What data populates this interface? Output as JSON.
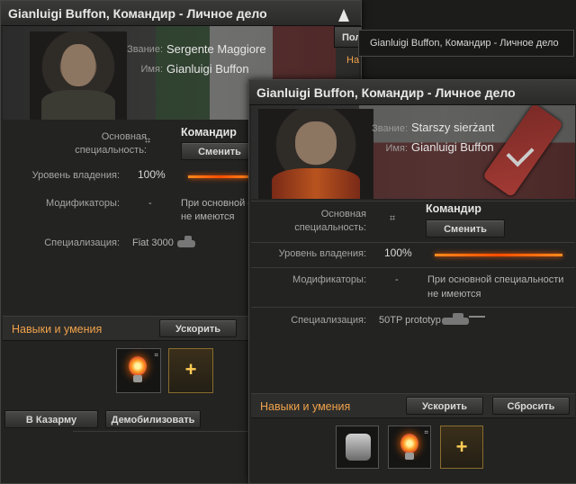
{
  "window_a": {
    "title": "Gianluigi Buffon, Командир - Личное дело",
    "rank_label": "Звание:",
    "rank_value": "Sergente Maggiore",
    "name_label": "Имя:",
    "name_value": "Gianluigi Buffon",
    "specialty_label": "Основная специальность:",
    "specialty_value": "Командир",
    "change_button": "Сменить",
    "proficiency_label": "Уровень владения:",
    "proficiency_value": "100%",
    "proficiency_fraction": 1.0,
    "modifiers_label": "Модификаторы:",
    "modifiers_value": "-",
    "modifiers_note": "При основной с не имеются",
    "specialization_label": "Специализация:",
    "specialization_value": "Fiat 3000",
    "skills_header": "Навыки и умения",
    "accelerate_button": "Ускорить",
    "barracks_button": "В Казарму",
    "demobilize_button": "Демобилизовать",
    "tab_label": "Пол",
    "tab2_label": "На"
  },
  "tooltip": {
    "text": "Gianluigi Buffon, Командир - Личное дело"
  },
  "window_b": {
    "title": "Gianluigi Buffon, Командир - Личное дело",
    "rank_label": "Звание:",
    "rank_value": "Starszy sierżant",
    "name_label": "Имя:",
    "name_value": "Gianluigi Buffon",
    "specialty_label_1": "Основная",
    "specialty_label_2": "специальность:",
    "specialty_value": "Командир",
    "change_button": "Сменить",
    "proficiency_label": "Уровень владения:",
    "proficiency_value": "100%",
    "proficiency_fraction": 1.0,
    "modifiers_label": "Модификаторы:",
    "modifiers_value": "-",
    "modifiers_note_1": "При основной специальности",
    "modifiers_note_2": "не имеются",
    "specialization_label": "Специализация:",
    "specialization_value": "50TP prototyp",
    "skills_header": "Навыки и умения",
    "accelerate_button": "Ускорить",
    "reset_button": "Сбросить"
  },
  "icons": {
    "binoculars": "binoculars-icon",
    "tank": "tank-icon",
    "bulb": "lightbulb-icon",
    "fist": "fist-icon",
    "add": "+"
  },
  "colors": {
    "accent_orange": "#f0a24c",
    "bar": "#ff5a00"
  }
}
